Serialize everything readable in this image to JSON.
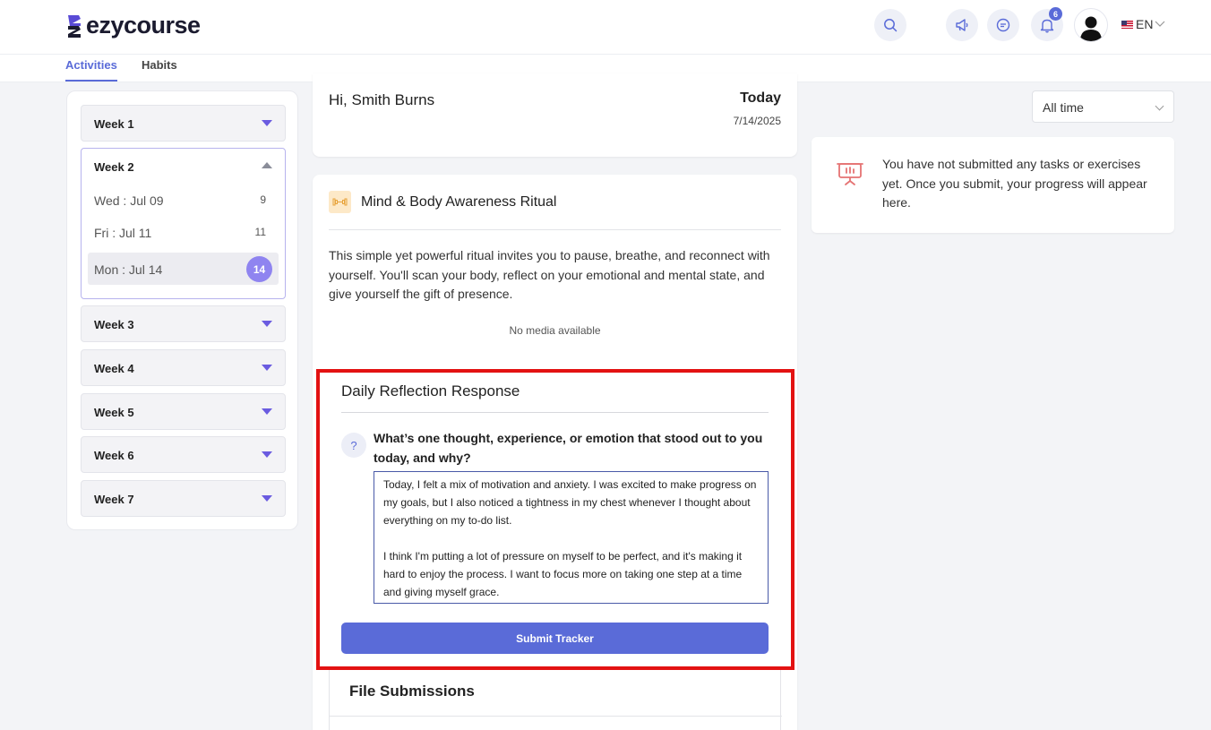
{
  "header": {
    "logo_text": "ezycourse",
    "notification_count": "6",
    "language": "EN",
    "icons": [
      "search-icon",
      "megaphone-icon",
      "chat-icon",
      "bell-icon",
      "user-icon"
    ]
  },
  "tabs": [
    {
      "label": "Activities",
      "active": true
    },
    {
      "label": "Habits",
      "active": false
    }
  ],
  "sidebar": {
    "weeks": [
      {
        "label": "Week 1"
      },
      {
        "label": "Week 2",
        "expanded": true,
        "days": [
          {
            "label": "Wed : Jul 09",
            "num": "9"
          },
          {
            "label": "Fri : Jul 11",
            "num": "11"
          },
          {
            "label": "Mon : Jul 14",
            "num": "14",
            "active": true
          }
        ]
      },
      {
        "label": "Week 3"
      },
      {
        "label": "Week 4"
      },
      {
        "label": "Week 5"
      },
      {
        "label": "Week 6"
      },
      {
        "label": "Week 7"
      }
    ]
  },
  "greeting": {
    "text": "Hi, Smith Burns",
    "today_label": "Today",
    "date": "7/14/2025"
  },
  "ritual": {
    "title": "Mind & Body Awareness Ritual",
    "description": "This simple yet powerful ritual invites you to pause, breathe, and reconnect with yourself. You'll scan your body, reflect on your emotional and mental state, and give yourself the gift of presence.",
    "no_media": "No media available"
  },
  "reflection": {
    "title": "Daily Reflection Response",
    "question": "What’s one thought, experience, or emotion that stood out to you today, and why?",
    "answer_p1": "Today, I felt a mix of motivation and anxiety. I was excited to make progress on my goals, but I also noticed a tightness in my chest whenever I thought about everything on my to-do list.",
    "answer_p2": "I think I'm putting a lot of pressure on myself to be perfect, and it's making it hard to enjoy the process. I want to focus more on taking one step at a time and giving myself grace.",
    "submit_label": "Submit Tracker"
  },
  "file_submissions": {
    "title": "File Submissions"
  },
  "right": {
    "filter_value": "All time",
    "empty_message": "You have not submitted any tasks or exercises yet. Once you submit, your progress will appear here."
  },
  "colors": {
    "accent": "#5a6bd8",
    "highlight_border": "#e31212",
    "active_day": "#8f84f0"
  }
}
